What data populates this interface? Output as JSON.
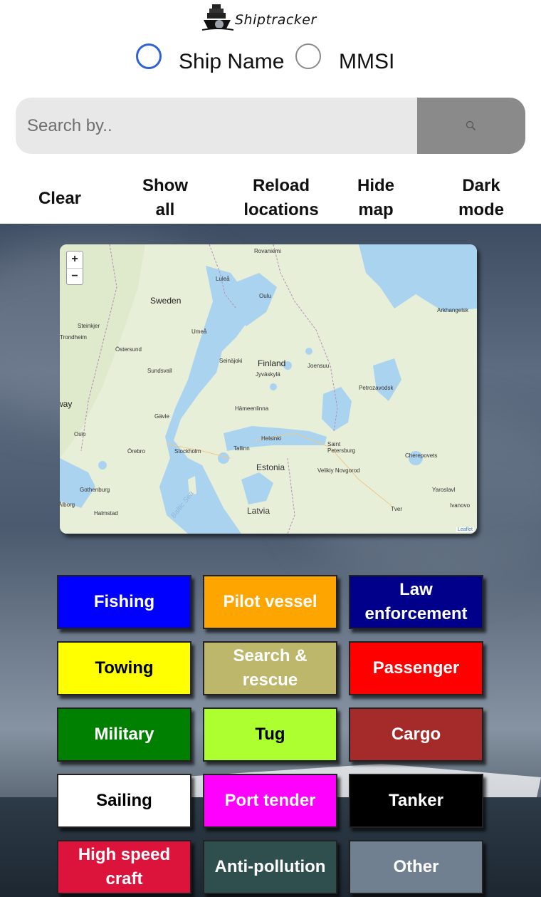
{
  "app": {
    "name": "Shiptracker"
  },
  "search_mode": {
    "options": [
      {
        "label": "Ship Name",
        "checked": true
      },
      {
        "label": "MMSI",
        "checked": false
      }
    ]
  },
  "search": {
    "placeholder": "Search by..",
    "value": "",
    "button_icon": "search-icon"
  },
  "actions": [
    {
      "label": "Clear"
    },
    {
      "label": "Show\nall"
    },
    {
      "label": "Reload\nlocations"
    },
    {
      "label": "Hide\nmap"
    },
    {
      "label": "Dark\nmode"
    }
  ],
  "map": {
    "zoom_in": "+",
    "zoom_out": "−",
    "attribution": "Leaflet",
    "places": [
      "Rovaniemi",
      "Luleå",
      "Oulu",
      "Sweden",
      "Arkhangelsk",
      "Steinkjer",
      "Trondheim",
      "Umeå",
      "Östersund",
      "Seinäjoki",
      "Finland",
      "Joensuu",
      "Jyväskylä",
      "Sundsvall",
      "Petrozavodsk",
      "way",
      "Hämeenlinna",
      "Gävle",
      "Oslo",
      "Helsinki",
      "Saint\nPetersburg",
      "Örebro",
      "Stockholm",
      "Tallinn",
      "Cherepovets",
      "Estonia",
      "Velikiy Novgorod",
      "Gothenburg",
      "Yaroslavl",
      "Ålborg",
      "Halmstad",
      "Latvia",
      "Tver",
      "Ivanovo",
      "Baltic Sea"
    ]
  },
  "categories": [
    {
      "label": "Fishing",
      "bg": "#0000ff",
      "fg": "#ffffff"
    },
    {
      "label": "Pilot vessel",
      "bg": "#ffa500",
      "fg": "#ffffff"
    },
    {
      "label": "Law\nenforcement",
      "bg": "#00008b",
      "fg": "#ffffff"
    },
    {
      "label": "Towing",
      "bg": "#ffff00",
      "fg": "#000000"
    },
    {
      "label": "Search &\nrescue",
      "bg": "#bdb76b",
      "fg": "#ffffff"
    },
    {
      "label": "Passenger",
      "bg": "#ff0000",
      "fg": "#ffffff"
    },
    {
      "label": "Military",
      "bg": "#008000",
      "fg": "#ffffff"
    },
    {
      "label": "Tug",
      "bg": "#adff2f",
      "fg": "#000000"
    },
    {
      "label": "Cargo",
      "bg": "#a52a2a",
      "fg": "#ffffff"
    },
    {
      "label": "Sailing",
      "bg": "#ffffff",
      "fg": "#000000"
    },
    {
      "label": "Port tender",
      "bg": "#ff00ff",
      "fg": "#ffffff"
    },
    {
      "label": "Tanker",
      "bg": "#000000",
      "fg": "#ffffff"
    },
    {
      "label": "High speed\ncraft",
      "bg": "#dc143c",
      "fg": "#ffffff"
    },
    {
      "label": "Anti-pollution",
      "bg": "#2f4f4f",
      "fg": "#ffffff"
    },
    {
      "label": "Other",
      "bg": "#708090",
      "fg": "#ffffff"
    }
  ]
}
